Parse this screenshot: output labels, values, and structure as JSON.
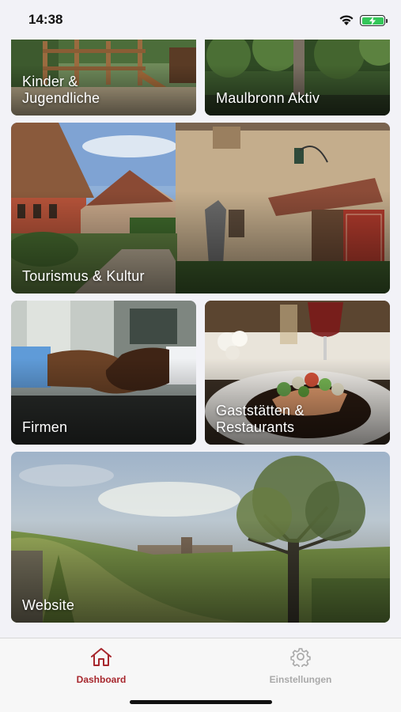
{
  "status_bar": {
    "time": "14:38",
    "wifi_icon": "wifi-icon",
    "battery_icon": "battery-charging-icon",
    "battery_color": "#34c759"
  },
  "tiles": {
    "kinder": {
      "label": "Kinder &\nJugendliche"
    },
    "maulbronn": {
      "label": "Maulbronn Aktiv"
    },
    "tourismus": {
      "label": "Tourismus & Kultur"
    },
    "firmen": {
      "label": "Firmen"
    },
    "gaststaetten": {
      "label": "Gaststätten &\nRestaurants"
    },
    "website": {
      "label": "Website"
    }
  },
  "tab_bar": {
    "accent_color": "#a7272d",
    "inactive_color": "#a9a9a9",
    "tabs": [
      {
        "label": "Dashboard",
        "icon": "home-icon",
        "active": true
      },
      {
        "label": "Einstellungen",
        "icon": "gear-icon",
        "active": false
      }
    ]
  }
}
